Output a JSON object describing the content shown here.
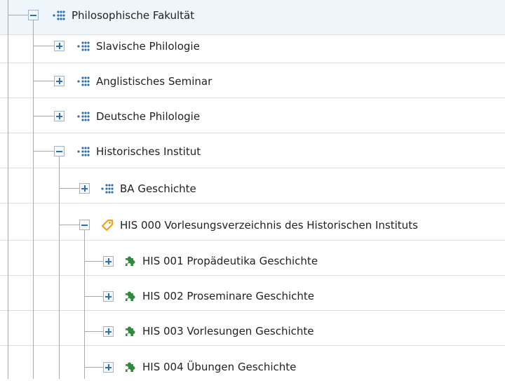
{
  "tree": {
    "root": {
      "label": "Philosophische Fakultät",
      "expanded": true,
      "icon": "org-unit-icon"
    },
    "nodes": [
      {
        "label": "Slavische Philologie",
        "expanded": false,
        "icon": "org-unit-icon"
      },
      {
        "label": "Anglistisches Seminar",
        "expanded": false,
        "icon": "org-unit-icon"
      },
      {
        "label": "Deutsche Philologie",
        "expanded": false,
        "icon": "org-unit-icon"
      },
      {
        "label": "Historisches Institut",
        "expanded": true,
        "icon": "org-unit-icon"
      },
      {
        "label": "BA Geschichte",
        "expanded": false,
        "icon": "org-unit-icon"
      },
      {
        "label": "HIS 000 Vorlesungsverzeichnis des Historischen Instituts",
        "expanded": true,
        "icon": "tag-icon"
      },
      {
        "label": "HIS 001 Propädeutika Geschichte",
        "expanded": false,
        "icon": "puzzle-icon"
      },
      {
        "label": "HIS 002 Proseminare Geschichte",
        "expanded": false,
        "icon": "puzzle-icon"
      },
      {
        "label": "HIS 003 Vorlesungen Geschichte",
        "expanded": false,
        "icon": "puzzle-icon"
      },
      {
        "label": "HIS 004 Übungen Geschichte",
        "expanded": false,
        "icon": "puzzle-icon"
      }
    ]
  },
  "colors": {
    "org_unit_icon": "#2f6fb0",
    "tag_icon": "#f0a020",
    "puzzle_icon": "#2e8b3a",
    "toggle": "#2f6fb0"
  }
}
